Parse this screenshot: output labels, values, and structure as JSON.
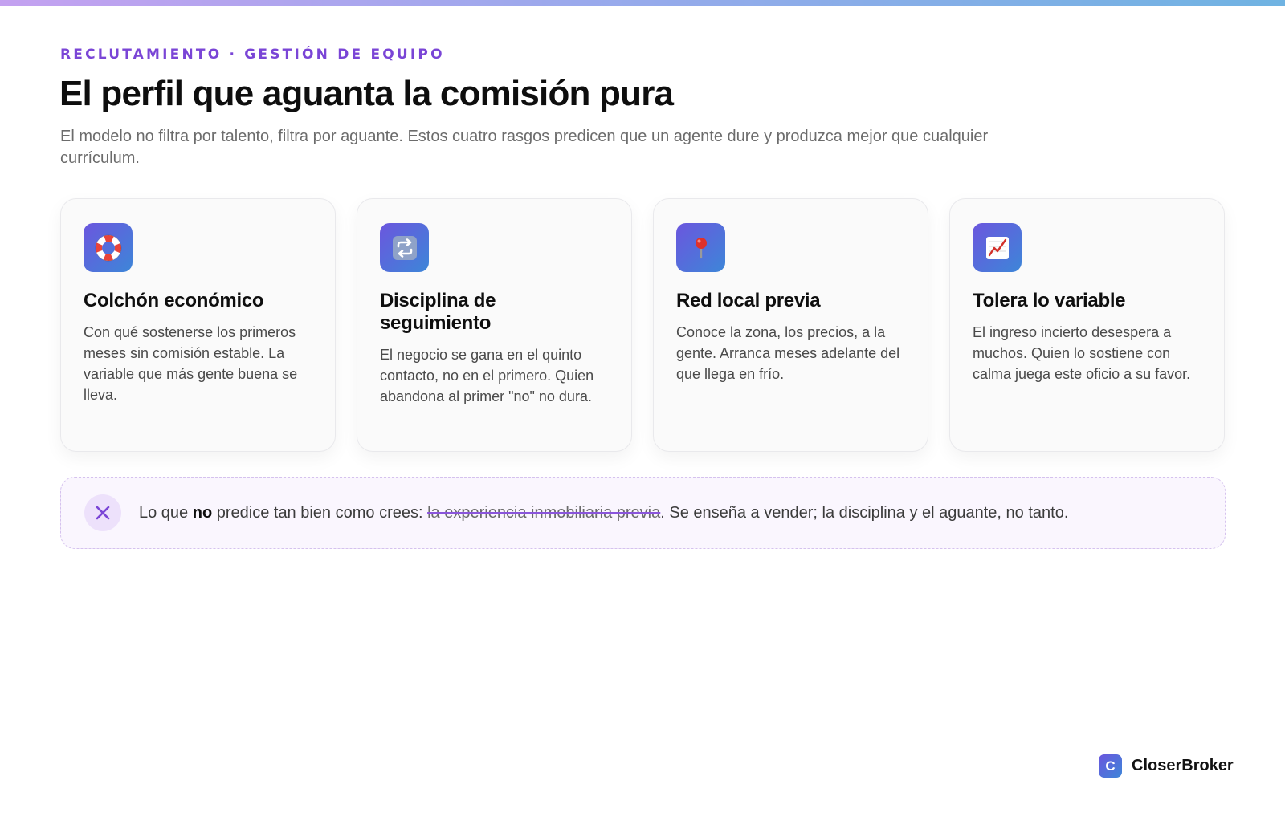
{
  "header": {
    "eyebrow": "RECLUTAMIENTO · GESTIÓN DE EQUIPO",
    "title": "El perfil que aguanta la comisión pura",
    "subtitle": "El modelo no filtra por talento, filtra por aguante. Estos cuatro rasgos predicen que un agente dure y produzca mejor que cualquier currículum."
  },
  "cards": [
    {
      "icon": "lifebuoy-icon",
      "title": "Colchón económico",
      "text": "Con qué sostenerse los primeros meses sin comisión estable. La variable que más gente buena se lleva."
    },
    {
      "icon": "repeat-icon",
      "title": "Disciplina de seguimiento",
      "text": "El negocio se gana en el quinto contacto, no en el primero. Quien abandona al primer \"no\" no dura."
    },
    {
      "icon": "map-pin-icon",
      "title": "Red local previa",
      "text": "Conoce la zona, los precios, a la gente. Arranca meses adelante del que llega en frío."
    },
    {
      "icon": "chart-increasing-icon",
      "title": "Tolera lo variable",
      "text": "El ingreso incierto desespera a muchos. Quien lo sostiene con calma juega este oficio a su favor."
    }
  ],
  "note": {
    "icon": "close-icon",
    "prefix": "Lo que ",
    "emphasis": "no",
    "middle": " predice tan bien como crees: ",
    "strikethrough": "la experiencia inmobiliaria previa",
    "suffix": ". Se enseña a vender; la disciplina y el aguante, no tanto."
  },
  "brand": {
    "mark": "C",
    "name": "CloserBroker"
  },
  "colors": {
    "accent": "#7a45d6",
    "gradient_start": "#6b56de",
    "gradient_end": "#3d86d8"
  }
}
